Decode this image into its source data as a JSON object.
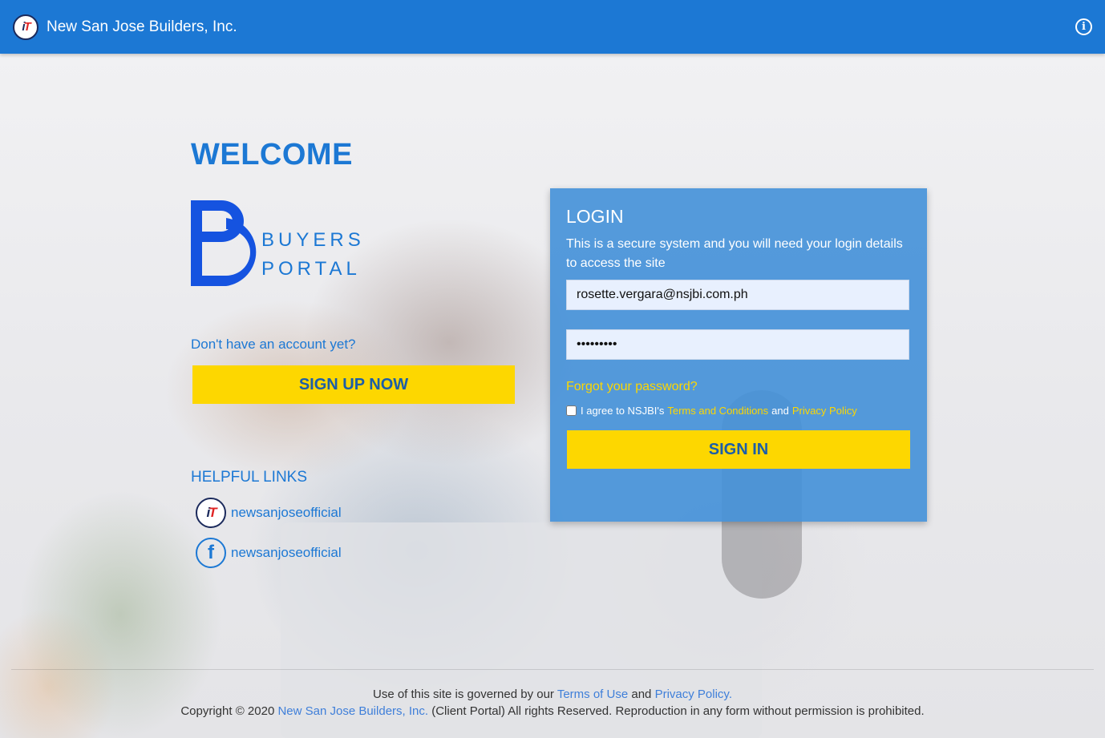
{
  "topbar": {
    "title": "New San Jose Builders, Inc."
  },
  "welcome": "WELCOME",
  "portal_logo": {
    "line1": "BUYERS",
    "line2": "PORTAL"
  },
  "signup": {
    "prompt": "Don't have an account yet?",
    "button_label": "SIGN UP NOW"
  },
  "helpful": {
    "title": "HELPFUL LINKS",
    "links": [
      {
        "label": "newsanjoseofficial",
        "icon": "nsjbi-logo-icon"
      },
      {
        "label": "newsanjoseofficial",
        "icon": "facebook-icon"
      }
    ]
  },
  "login": {
    "title": "LOGIN",
    "description": "This is a secure system and you will need your login details to access the site",
    "email_value": "rosette.vergara@nsjbi.com.ph",
    "password_value": "password1",
    "forgot_label": "Forgot your password?",
    "agree_prefix": "I agree to NSJBI's",
    "terms_label": "Terms and Conditions",
    "and": "and",
    "privacy_label": "Privacy Policy",
    "signin_label": "SIGN IN"
  },
  "footer": {
    "line1_prefix": "Use of this site is governed by our",
    "terms_link": "Terms of Use",
    "and": "and",
    "privacy_link": "Privacy Policy.",
    "copyright_prefix": "Copyright © 2020",
    "company_link": "New San Jose Builders, Inc.",
    "copyright_suffix": "(Client Portal) All rights Reserved. Reproduction in any form without permission is prohibited."
  },
  "colors": {
    "primary": "#1c78d4",
    "accent_yellow": "#fdd700",
    "panel": "#4290d8"
  }
}
